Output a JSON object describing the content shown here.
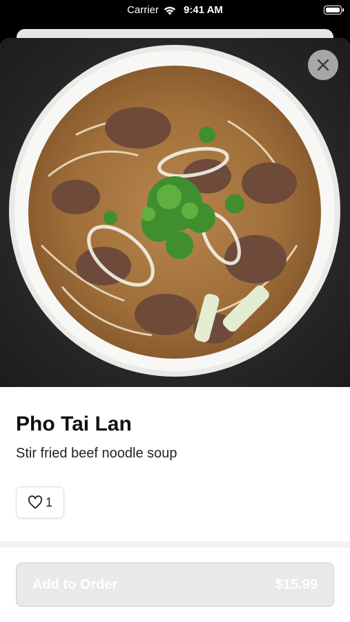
{
  "status_bar": {
    "carrier": "Carrier",
    "time": "9:41 AM",
    "wifi_icon": "wifi-icon",
    "battery_icon": "battery-icon"
  },
  "product": {
    "image": "pho-bowl-image",
    "name": "Pho Tai Lan",
    "description": "Stir fried beef noodle soup",
    "likes": "1"
  },
  "actions": {
    "close_icon": "close-icon",
    "like_icon": "heart-icon",
    "add_to_order_label": "Add to Order",
    "price": "$15.99"
  },
  "colors": {
    "hero_background": "#2a2a2a",
    "button_disabled": "#e9e9e9"
  }
}
